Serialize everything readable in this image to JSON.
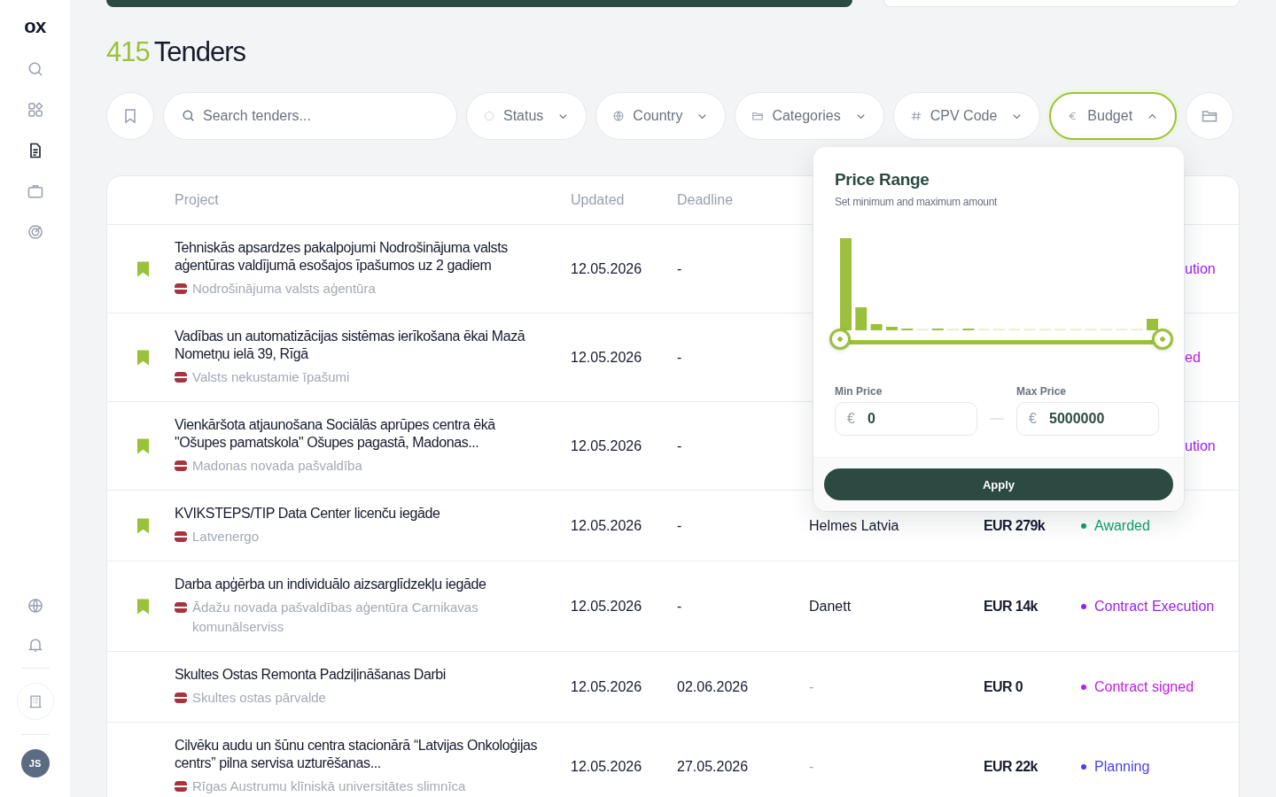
{
  "sidebar": {
    "logo": "ox",
    "nav": [
      {
        "selected": false
      },
      {
        "selected": false
      },
      {
        "selected": true
      },
      {
        "selected": false
      },
      {
        "selected": false
      }
    ],
    "avatar": "JS"
  },
  "title": {
    "count": "415",
    "text": "Tenders"
  },
  "filters": {
    "search": {
      "placeholder": "Search tenders..."
    },
    "dropdowns": [
      {
        "label": "Status",
        "open": false
      },
      {
        "label": "Country",
        "open": false
      },
      {
        "label": "Categories",
        "open": false
      },
      {
        "label": "CPV Code",
        "open": false
      },
      {
        "label": "Budget",
        "open": true
      }
    ]
  },
  "table": {
    "columns": [
      {
        "label": "Project"
      },
      {
        "label": "Updated"
      },
      {
        "label": "Deadline"
      }
    ],
    "rows": [
      {
        "bookmarked": true,
        "title": "Tehniskās apsardzes pakalpojumi Nodrošinājuma valsts aģentūras valdījumā esošajos īpašumos uz 2 gadiem",
        "buyer": "Nodrošinājuma valsts aģentūra",
        "updated": "12.05.2026",
        "deadline": "-",
        "covered": true,
        "status": {
          "label": "ution",
          "color": "#9b1ff5"
        }
      },
      {
        "bookmarked": true,
        "title": "Vadības un automatizācijas sistēmas ierīkošana ēkai Mazā Nometņu ielā 39, Rīgā",
        "buyer": "Valsts nekustamie īpašumi",
        "updated": "12.05.2026",
        "deadline": "-",
        "covered": true,
        "status": {
          "label": "ed",
          "color": "#c21ee6"
        }
      },
      {
        "bookmarked": true,
        "title": "Vienkāršota atjaunošana Sociālās aprūpes centra ēkā \"Ošupes pamatskola\" Ošupes pagastā, Madonas...",
        "buyer": "Madonas novada pašvaldība",
        "updated": "12.05.2026",
        "deadline": "-",
        "covered": true,
        "status": {
          "label": "ution",
          "color": "#9b1ff5"
        }
      },
      {
        "bookmarked": true,
        "title": "KVIKSTEPS/TIP Data Center licenču iegāde",
        "buyer": "Latvenergo",
        "updated": "12.05.2026",
        "deadline": "-",
        "winner": "Helmes Latvia",
        "winner_muted": false,
        "covered": false,
        "value": "EUR 279k",
        "status": {
          "label": "Awarded",
          "color": "#10a06a"
        }
      },
      {
        "bookmarked": true,
        "title": "Darba apģērba un individuālo aizsarglīdzekļu iegāde",
        "buyer": "Ādažu novada pašvaldības aģentūra Carnikavas komunālserviss",
        "updated": "12.05.2026",
        "deadline": "-",
        "winner": "Danett",
        "winner_muted": false,
        "covered": false,
        "value": "EUR 14k",
        "status": {
          "label": "Contract Execution",
          "color": "#9b1ff5"
        }
      },
      {
        "bookmarked": false,
        "title": "Skultes Ostas Remonta Padziļināšanas Darbi",
        "buyer": "Skultes ostas pārvalde",
        "updated": "12.05.2026",
        "deadline": "02.06.2026",
        "winner": "-",
        "winner_muted": true,
        "covered": false,
        "value": "EUR 0",
        "status": {
          "label": "Contract signed",
          "color": "#c21ee6"
        }
      },
      {
        "bookmarked": false,
        "title": "Cilvēku audu un šūnu centra stacionārā “Latvijas Onkoloģijas centrs” pilna servisa uzturēšanas...",
        "buyer": "Rīgas Austrumu klīniskā universitātes slimnīca",
        "updated": "12.05.2026",
        "deadline": "27.05.2026",
        "winner": "-",
        "winner_muted": true,
        "covered": false,
        "value": "EUR 22k",
        "status": {
          "label": "Planning",
          "color": "#4b3ff0"
        }
      }
    ]
  },
  "price_popup": {
    "title": "Price Range",
    "subtitle": "Set minimum and maximum amount",
    "range": {
      "low": {
        "level": 0
      },
      "high": {
        "level": 1
      }
    },
    "min": {
      "label": "Min Price",
      "currency": "€",
      "value": "0"
    },
    "max": {
      "label": "Max Price",
      "currency": "€",
      "value": "5000000"
    },
    "apply": "Apply"
  }
}
